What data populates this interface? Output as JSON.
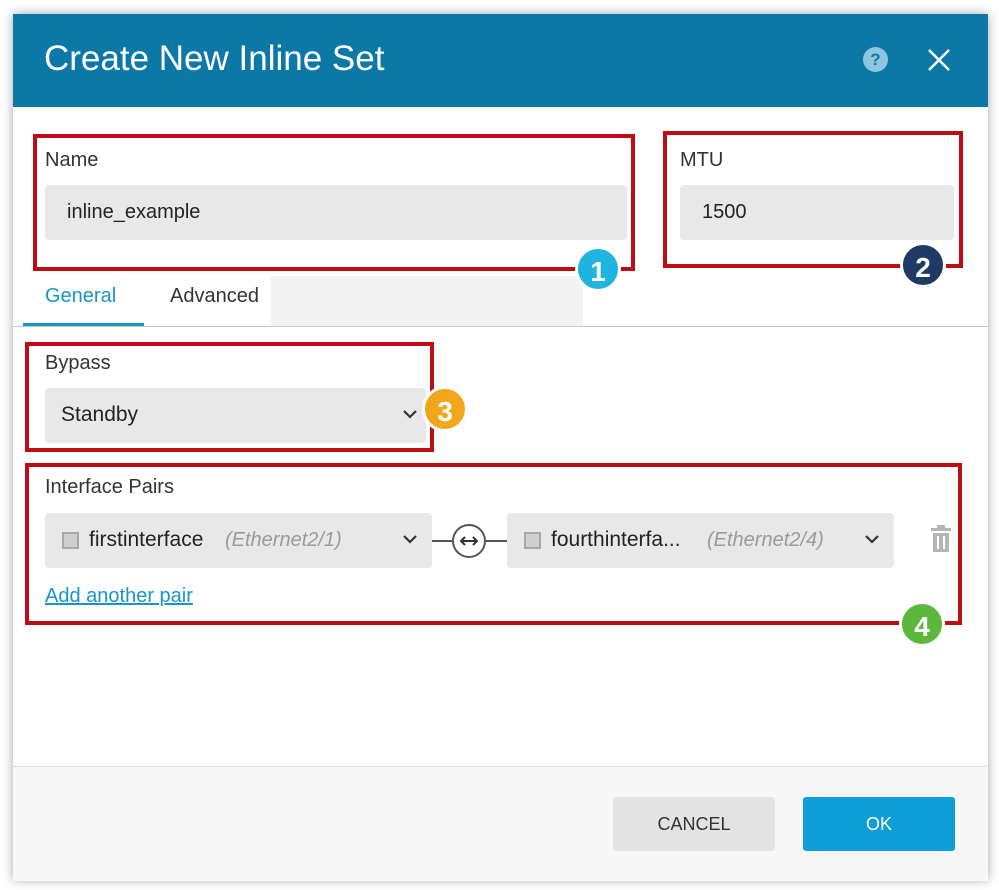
{
  "dialog": {
    "title": "Create New Inline Set",
    "help_icon": "question-circle-icon",
    "help_glyph": "?",
    "close_icon": "close-icon"
  },
  "name_field": {
    "label": "Name",
    "value": "inline_example"
  },
  "mtu_field": {
    "label": "MTU",
    "value": "1500"
  },
  "tabs": [
    {
      "label": "General",
      "active": true
    },
    {
      "label": "Advanced",
      "active": false
    }
  ],
  "bypass": {
    "label": "Bypass",
    "selected": "Standby"
  },
  "interface_pairs": {
    "label": "Interface Pairs",
    "pairs": [
      {
        "left": {
          "name": "firstinterface",
          "port": "(Ethernet2/1)"
        },
        "right": {
          "name": "fourthinterfa...",
          "port": "(Ethernet2/4)"
        }
      }
    ],
    "add_link": "Add another pair"
  },
  "annotations": [
    {
      "number": "1",
      "color": "#1fb5e0"
    },
    {
      "number": "2",
      "color": "#1f3a64"
    },
    {
      "number": "3",
      "color": "#f2a71b"
    },
    {
      "number": "4",
      "color": "#5cb83c"
    }
  ],
  "annotation_border_color": "#bd0d14",
  "footer": {
    "cancel_label": "CANCEL",
    "ok_label": "OK"
  },
  "colors": {
    "header": "#0b78a8",
    "accent": "#1795c9",
    "ok_button": "#0d9ed8"
  }
}
